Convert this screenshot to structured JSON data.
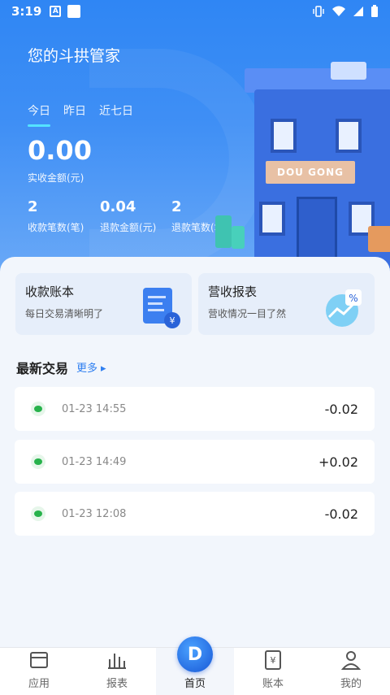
{
  "status_bar": {
    "time": "3:19"
  },
  "header": {
    "title": "您的斗拱管家",
    "tabs": [
      "今日",
      "昨日",
      "近七日"
    ],
    "amount": "0.00",
    "amount_label": "实收金额(元)",
    "stats": [
      {
        "value": "2",
        "label": "收款笔数(笔)"
      },
      {
        "value": "0.04",
        "label": "退款金额(元)"
      },
      {
        "value": "2",
        "label": "退款笔数(笔)"
      }
    ],
    "building_sign": "DOU GONG"
  },
  "cards": [
    {
      "title": "收款账本",
      "subtitle": "每日交易清晰明了",
      "icon": "ledger-icon"
    },
    {
      "title": "营收报表",
      "subtitle": "营收情况一目了然",
      "icon": "report-chart-icon"
    }
  ],
  "transactions_section": {
    "title": "最新交易",
    "more_label": "更多"
  },
  "transactions": [
    {
      "time": "01-23 14:55",
      "amount": "-0.02"
    },
    {
      "time": "01-23 14:49",
      "amount": "+0.02"
    },
    {
      "time": "01-23 12:08",
      "amount": "-0.02"
    }
  ],
  "nav": [
    {
      "label": "应用",
      "icon": "app-icon"
    },
    {
      "label": "报表",
      "icon": "chart-icon"
    },
    {
      "label": "首页",
      "icon": "home-logo-icon"
    },
    {
      "label": "账本",
      "icon": "ledger-icon"
    },
    {
      "label": "我的",
      "icon": "user-icon"
    }
  ],
  "colors": {
    "primary": "#2f86f4",
    "accent": "#54e3ff",
    "wechat": "#27b24b"
  }
}
